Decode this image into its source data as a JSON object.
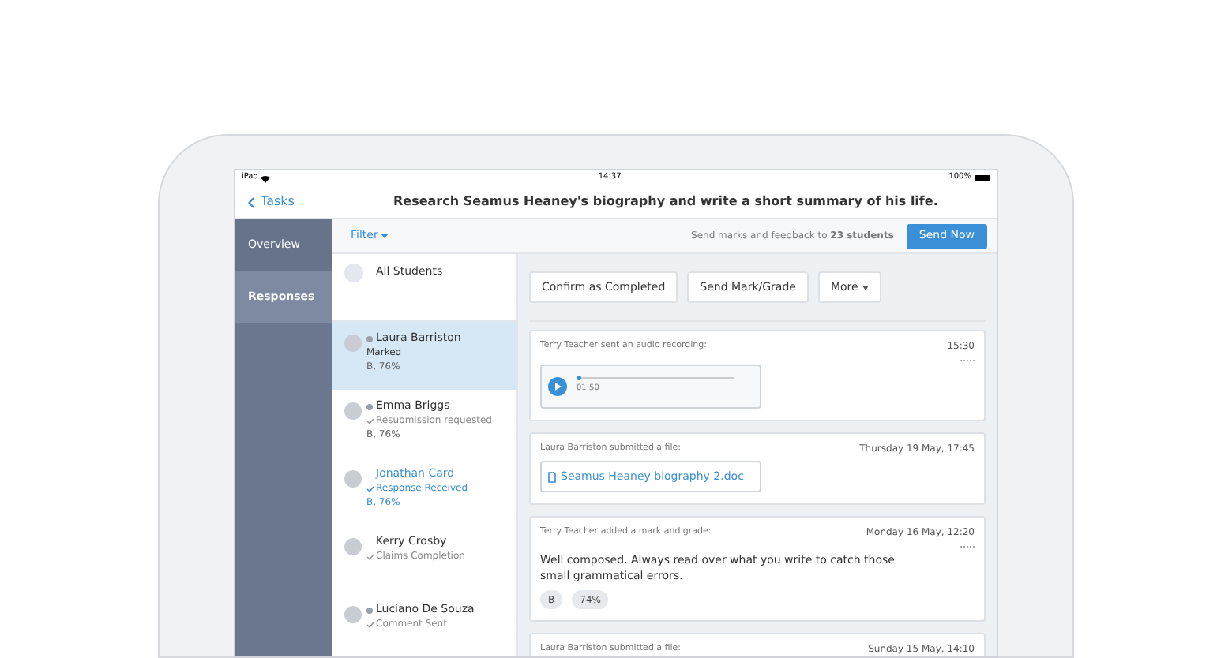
{
  "status_bar": {
    "device": "iPad",
    "time": "14:37",
    "battery": "100%"
  },
  "nav": {
    "back": "Tasks",
    "title": "Research Seamus Heaney's biography and write a short summary of his life."
  },
  "sidebar": {
    "items": [
      {
        "label": "Overview",
        "selected": false
      },
      {
        "label": "Responses",
        "selected": true
      }
    ]
  },
  "filter": {
    "label": "Filter"
  },
  "send_bar": {
    "text": "Send marks and feedback to **23 students**",
    "button": "Send Now"
  },
  "all_students": "All Students",
  "students": [
    {
      "name": "Laura Barriston",
      "status": "Marked",
      "grade": "B, 76%",
      "selected": true,
      "highlighted": false,
      "flagged": true,
      "checked": false
    },
    {
      "name": "Emma Briggs",
      "status": "Resubmission requested",
      "grade": "B, 76%",
      "selected": false,
      "highlighted": false,
      "flagged": true,
      "checked": true
    },
    {
      "name": "Jonathan Card",
      "status": "Response Received",
      "grade": "B, 76%",
      "selected": false,
      "highlighted": true,
      "flagged": false,
      "checked": true
    },
    {
      "name": "Kerry Crosby",
      "status": "Claims Completion",
      "selected": false,
      "highlighted": false,
      "flagged": false,
      "checked": true
    },
    {
      "name": "Luciano De Souza",
      "status": "Comment Sent",
      "selected": false,
      "highlighted": false,
      "flagged": true,
      "checked": true
    }
  ],
  "actions": [
    {
      "label": "Confirm as Completed",
      "dropdown": false
    },
    {
      "label": "Send Mark/Grade",
      "dropdown": false
    },
    {
      "label": "More",
      "dropdown": true
    }
  ],
  "feed": [
    {
      "kind": "audio",
      "header": "Terry Teacher sent an audio recording:",
      "time": "15:30",
      "duration": "01:50",
      "level": 0.03
    },
    {
      "kind": "file",
      "header": "Laura Barriston submitted a file:",
      "time": "Thursday 19 May, 17:45",
      "file": "Seamus Heaney biography 2.doc"
    },
    {
      "kind": "grade",
      "header": "Terry Teacher added a mark and grade:",
      "time": "Monday 16 May, 12:20",
      "comment": "Well composed. Always read over what you write to catch those small grammatical errors.",
      "grade": "B",
      "percent": "74%"
    },
    {
      "kind": "file",
      "header": "Laura Barriston submitted a file:",
      "time": "Sunday 15 May, 14:10"
    }
  ]
}
